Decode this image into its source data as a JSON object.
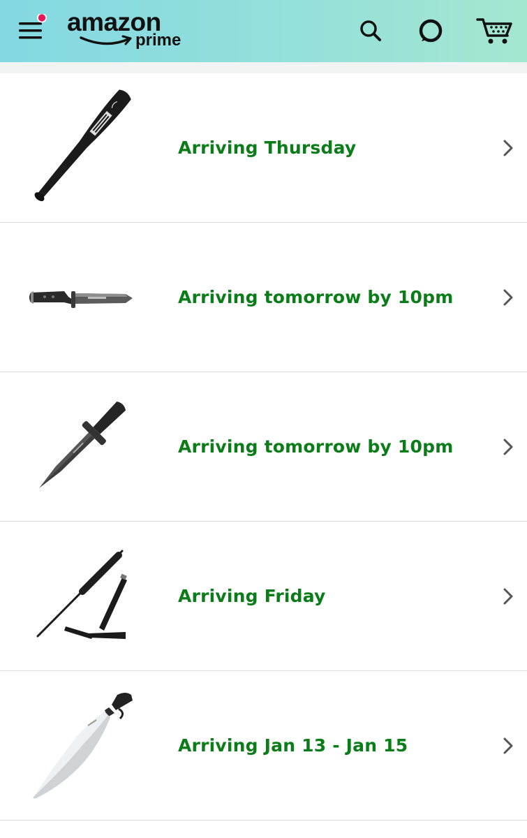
{
  "header": {
    "logo_word": "amazon",
    "logo_sub": "prime",
    "gradient_start": "#84d8e2",
    "gradient_end": "#a5e6d0",
    "notification_dot_color": "#e8195a",
    "icons": [
      "menu-icon",
      "search-icon",
      "alexa-icon",
      "cart-icon"
    ]
  },
  "orders": [
    {
      "item_image": "baseball-bat",
      "status": "Arriving Thursday"
    },
    {
      "item_image": "tactical-knife",
      "status": "Arriving tomorrow by 10pm"
    },
    {
      "item_image": "dagger",
      "status": "Arriving tomorrow by 10pm"
    },
    {
      "item_image": "expandable-baton",
      "status": "Arriving Friday"
    },
    {
      "item_image": "machete-sword",
      "status": "Arriving Jan 13 - Jan 15"
    }
  ],
  "colors": {
    "status_green": "#0a7d18",
    "divider": "#dcdcdc",
    "chevron": "#555555"
  }
}
